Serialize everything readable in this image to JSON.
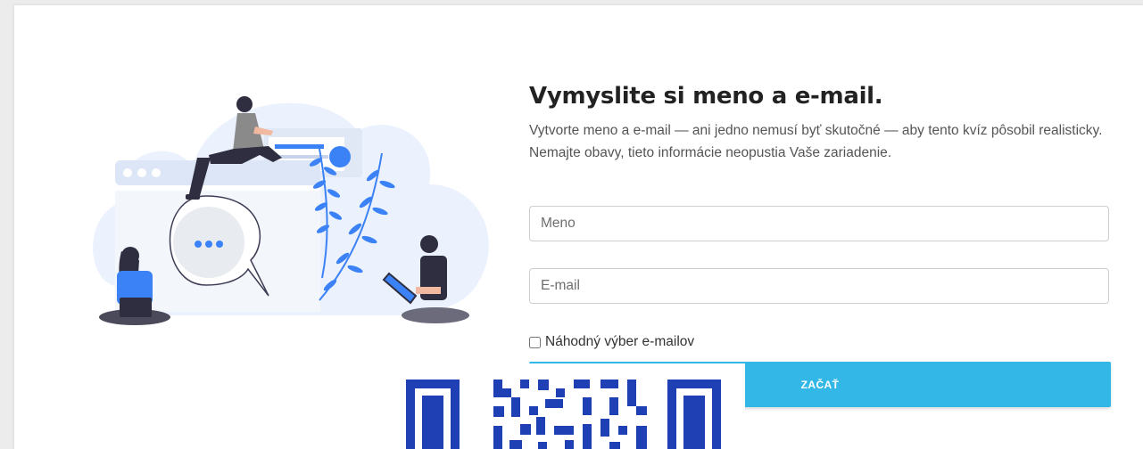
{
  "form": {
    "title": "Vymyslite si meno a e-mail.",
    "description": "Vytvorte meno a e-mail — ani jedno nemusí byť skutočné — aby tento kvíz pôsobil realisticky. Nemajte obavy, tieto informácie neopustia Vaše zariadenie.",
    "name_placeholder": "Meno",
    "name_value": "",
    "email_placeholder": "E-mail",
    "email_value": "",
    "random_email_label": "Náhodný výber e-mailov",
    "random_email_checked": false,
    "start_button_label": "ZAČAŤ"
  },
  "colors": {
    "accent": "#33b7e6",
    "illustration_blue": "#3b82f6",
    "cloud": "#ebf1fd",
    "qr_blue": "#1f3fb4"
  },
  "icons": {
    "illustration": "people-with-devices-illustration",
    "qr": "qr-code"
  }
}
